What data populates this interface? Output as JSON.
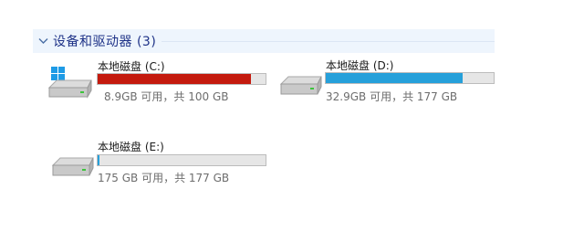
{
  "group": {
    "title": "设备和驱动器 (3)"
  },
  "drives": [
    {
      "name": "本地磁盘 (C:)",
      "info": "8.9GB 可用，共 100 GB",
      "used_fraction": 0.911,
      "bar_color": "#c41a0e",
      "icon": "windows-drive-icon"
    },
    {
      "name": "本地磁盘 (D:)",
      "info": "32.9GB 可用，共 177 GB",
      "used_fraction": 0.814,
      "bar_color": "#26a0da",
      "icon": "hard-drive-icon"
    },
    {
      "name": "本地磁盘 (E:)",
      "info": "175 GB 可用，共 177 GB",
      "used_fraction": 0.011,
      "bar_color": "#26a0da",
      "icon": "hard-drive-icon"
    }
  ]
}
